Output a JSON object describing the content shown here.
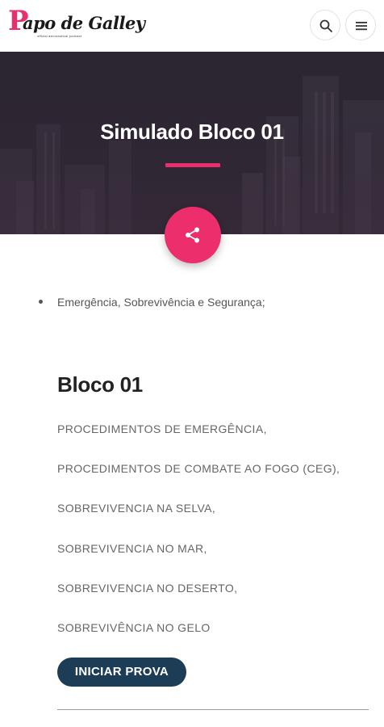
{
  "header": {
    "logo_initial": "P",
    "logo_script": "apo de Galley",
    "logo_tagline": "official aeronautical podcast"
  },
  "icons": {
    "search": "search-icon",
    "menu": "hamburger-menu-icon",
    "share": "share-icon"
  },
  "hero": {
    "title": "Simulado Bloco 01"
  },
  "content": {
    "bullets": [
      "Emergência, Sobrevivência e Segurança;"
    ],
    "section_title": "Bloco 01",
    "topics": [
      "PROCEDIMENTOS DE EMERGÊNCIA,",
      "PROCEDIMENTOS DE COMBATE AO FOGO (CEG),",
      "SOBREVIVENCIA NA SELVA,",
      "SOBREVIVENCIA NO MAR,",
      "SOBREVIVENCIA NO DESERTO,",
      "SOBREVIVÊNCIA NO GELO"
    ],
    "start_button": "INICIAR PROVA"
  },
  "colors": {
    "accent": "#e8306d",
    "button": "#1c3d55"
  }
}
